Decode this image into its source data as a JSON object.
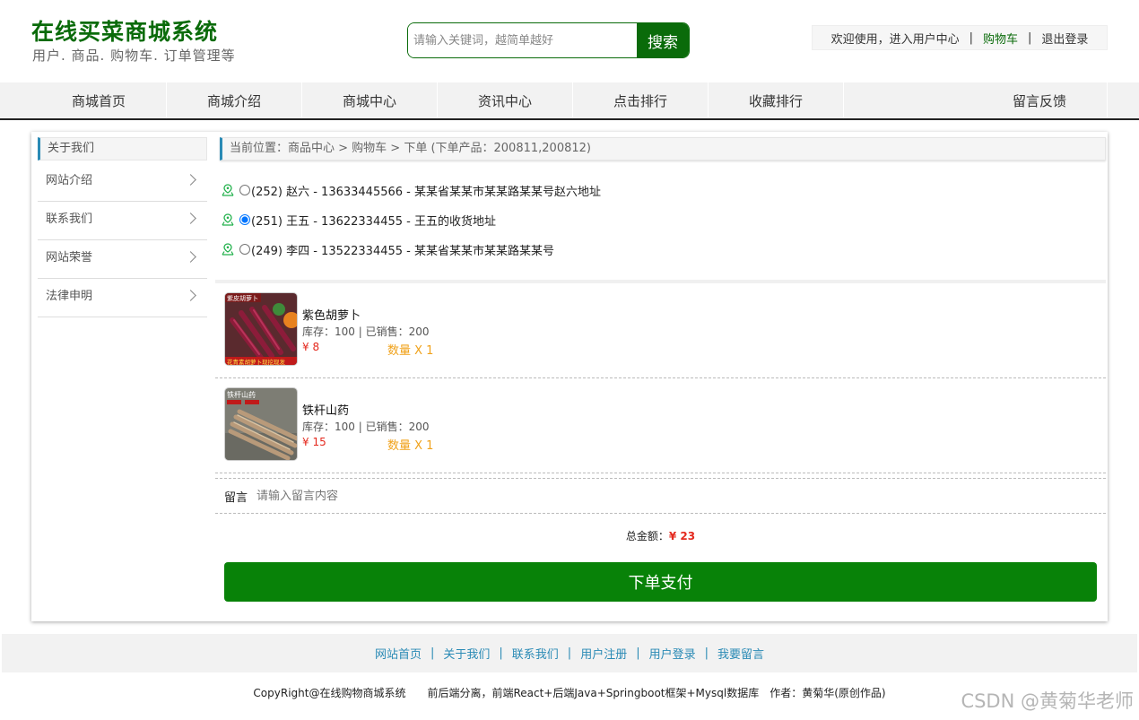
{
  "header": {
    "title": "在线买菜商城系统",
    "subtitle": "用户. 商品. 购物车. 订单管理等",
    "search_placeholder": "请输入关键词，越简单越好",
    "search_button": "搜索",
    "welcome": "欢迎使用，进入用户中心",
    "cart": "购物车",
    "logout": "退出登录"
  },
  "nav": [
    "商城首页",
    "商城介绍",
    "商城中心",
    "资讯中心",
    "点击排行",
    "收藏排行",
    "留言反馈"
  ],
  "sidebar": {
    "title": "关于我们",
    "items": [
      "网站介绍",
      "联系我们",
      "网站荣誉",
      "法律申明"
    ]
  },
  "breadcrumb": "当前位置：商品中心 > 购物车 > 下单 (下单产品：200811,200812)",
  "addresses": [
    {
      "text": "(252) 赵六 - 13633445566 - 某某省某某市某某路某某号赵六地址",
      "selected": false
    },
    {
      "text": "(251) 王五 - 13622334455 - 王五的收货地址",
      "selected": true
    },
    {
      "text": "(249) 李四 - 13522334455 - 某某省某某市某某路某某号",
      "selected": false
    }
  ],
  "products": [
    {
      "name": "紫色胡萝卜",
      "stock": "库存：100 | 已销售：200",
      "price": "¥ 8",
      "qty": "数量 X 1",
      "img_top_label": "紫皮胡萝卜",
      "img_bottom_label": "花青素胡萝卜现挖现发"
    },
    {
      "name": "铁杆山药",
      "stock": "库存：100 | 已销售：200",
      "price": "¥ 15",
      "qty": "数量 X 1",
      "img_top_label": "铁杆山药"
    }
  ],
  "note": {
    "label": "留言",
    "placeholder": "请输入留言内容"
  },
  "total": {
    "label": "总金额：",
    "amount": "¥ 23"
  },
  "pay_button": "下单支付",
  "footer": {
    "links": [
      "网站首页",
      "关于我们",
      "联系我们",
      "用户注册",
      "用户登录",
      "我要留言"
    ],
    "copyright": "CopyRight@在线购物商城系统　　前后端分离，前端React+后端Java+Springboot框架+Mysql数据库　作者：黄菊华(原创作品)"
  },
  "watermark": "CSDN @黄菊华老师",
  "colors": {
    "brand_green": "#0a6b0a",
    "pay_green": "#088208",
    "price_red": "#e4291e",
    "qty_orange": "#f0a21b",
    "accent_blue": "#2a8ab5"
  }
}
